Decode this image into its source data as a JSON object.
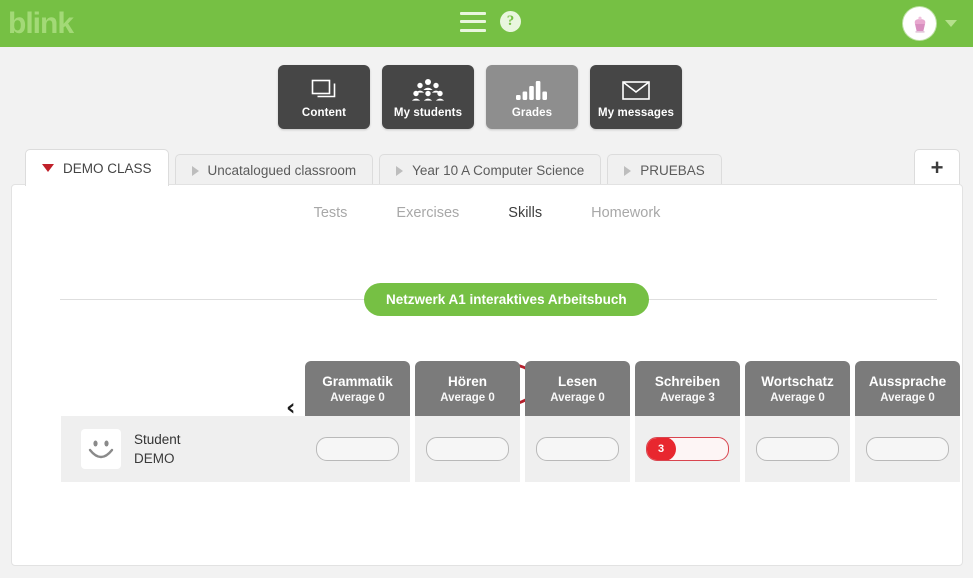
{
  "topbar": {
    "logo": "blink",
    "menu_icon": "hamburger-icon",
    "help_icon": "?",
    "avatar_icon": "cupcake-avatar"
  },
  "modules": [
    {
      "label": "Content",
      "icon": "windows-icon",
      "active": false
    },
    {
      "label": "My students",
      "icon": "people-icon",
      "active": false
    },
    {
      "label": "Grades",
      "icon": "barchart-icon",
      "active": true
    },
    {
      "label": "My messages",
      "icon": "envelope-icon",
      "active": false
    }
  ],
  "class_tabs": {
    "tabs": [
      {
        "label": "DEMO CLASS",
        "active": true
      },
      {
        "label": "Uncatalogued classroom",
        "active": false
      },
      {
        "label": "Year 10 A Computer Science",
        "active": false
      },
      {
        "label": "PRUEBAS",
        "active": false
      }
    ],
    "add_label": "+"
  },
  "subtabs": [
    {
      "label": "Tests",
      "current": false
    },
    {
      "label": "Exercises",
      "current": false
    },
    {
      "label": "Skills",
      "current": true
    },
    {
      "label": "Homework",
      "current": false
    }
  ],
  "book": {
    "title": "Netzwerk A1 interaktives Arbeitsbuch"
  },
  "grid": {
    "scroll_left": "‹",
    "scroll_right": "›",
    "columns": [
      {
        "name": "Grammatik",
        "average": "Average 0"
      },
      {
        "name": "Hören",
        "average": "Average 0"
      },
      {
        "name": "Lesen",
        "average": "Average 0"
      },
      {
        "name": "Schreiben",
        "average": "Average 3"
      },
      {
        "name": "Wortschatz",
        "average": "Average 0"
      },
      {
        "name": "Aussprache",
        "average": "Average 0"
      }
    ],
    "student": {
      "first_line": "Student",
      "second_line": "DEMO"
    },
    "scores": [
      "",
      "",
      "",
      "3",
      "",
      ""
    ]
  },
  "colors": {
    "brand_green": "#76c044",
    "accent_red": "#e8272f",
    "header_gray": "#7b7b7b",
    "module_dark": "#464646",
    "module_active": "#8e8e8e"
  }
}
